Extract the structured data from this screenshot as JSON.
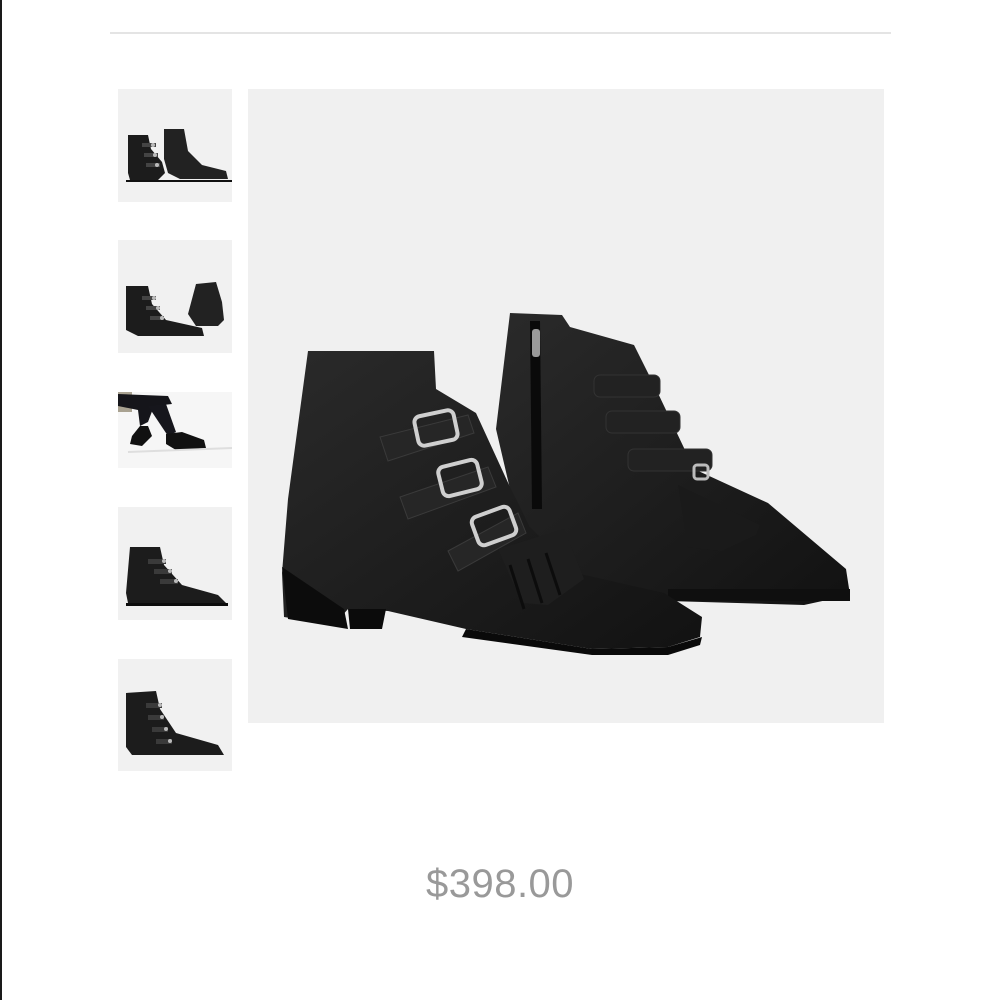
{
  "product": {
    "price": "$398.00",
    "main_image_icon": "ankle-boots-pair-icon"
  },
  "gallery": {
    "thumbnails": [
      {
        "icon": "boots-pair-front-icon"
      },
      {
        "icon": "boots-pair-side-back-icon"
      },
      {
        "icon": "boots-worn-model-icon"
      },
      {
        "icon": "single-boot-side-icon"
      },
      {
        "icon": "single-boot-angle-icon"
      }
    ]
  },
  "colors": {
    "price_text": "#999999",
    "image_background": "#f0f0f0",
    "leather": "#1c1c1c",
    "buckle": "#c8c8c8"
  }
}
